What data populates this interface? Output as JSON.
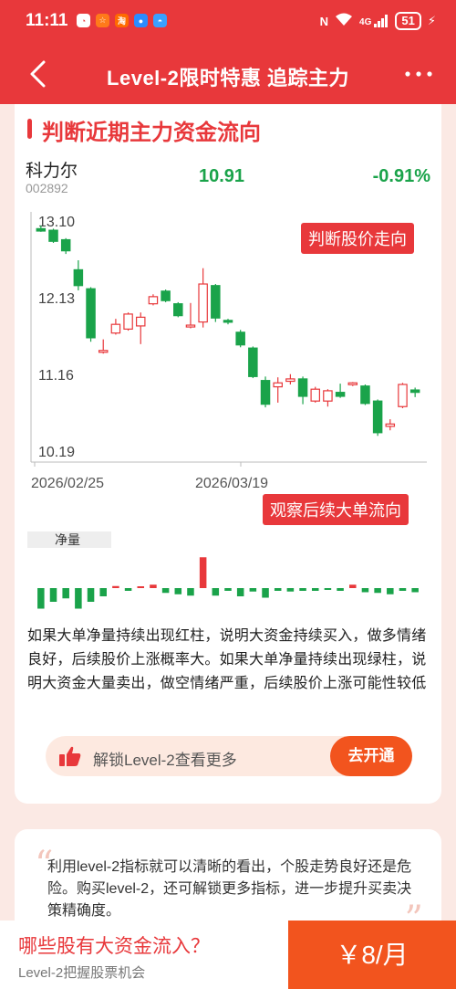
{
  "statusbar": {
    "time": "11:11",
    "apps": [
      "◔",
      "淘",
      "淘",
      "●",
      "◓"
    ],
    "network": "4G",
    "battery": "51"
  },
  "nav": {
    "title": "Level-2限时特惠 追踪主力"
  },
  "section": {
    "title": "判断近期主力资金流向"
  },
  "stock": {
    "name": "科力尔",
    "code": "002892",
    "price": "10.91",
    "change": "-0.91%"
  },
  "chart_data": {
    "type": "candlestick",
    "y_ticks": [
      "13.10",
      "12.13",
      "11.16",
      "10.19"
    ],
    "x_ticks": [
      "2026/02/25",
      "2026/03/19"
    ],
    "ylim": [
      10.19,
      13.1
    ],
    "candles": [
      {
        "o": 12.98,
        "c": 12.95,
        "h": 13.02,
        "l": 12.94
      },
      {
        "o": 12.96,
        "c": 12.82,
        "h": 12.98,
        "l": 12.8
      },
      {
        "o": 12.84,
        "c": 12.7,
        "h": 12.86,
        "l": 12.66
      },
      {
        "o": 12.46,
        "c": 12.26,
        "h": 12.58,
        "l": 12.2
      },
      {
        "o": 12.22,
        "c": 11.6,
        "h": 12.24,
        "l": 11.55
      },
      {
        "o": 11.42,
        "c": 11.44,
        "h": 11.58,
        "l": 11.4
      },
      {
        "o": 11.66,
        "c": 11.77,
        "h": 11.84,
        "l": 11.64
      },
      {
        "o": 11.71,
        "c": 11.9,
        "h": 11.92,
        "l": 11.69
      },
      {
        "o": 11.75,
        "c": 11.86,
        "h": 11.92,
        "l": 11.52
      },
      {
        "o": 12.03,
        "c": 12.12,
        "h": 12.15,
        "l": 12.01
      },
      {
        "o": 12.19,
        "c": 12.07,
        "h": 12.21,
        "l": 12.05
      },
      {
        "o": 12.03,
        "c": 11.88,
        "h": 12.05,
        "l": 11.86
      },
      {
        "o": 11.74,
        "c": 11.76,
        "h": 12.04,
        "l": 11.72
      },
      {
        "o": 11.8,
        "c": 12.28,
        "h": 12.48,
        "l": 11.73
      },
      {
        "o": 12.26,
        "c": 11.85,
        "h": 12.28,
        "l": 11.8
      },
      {
        "o": 11.82,
        "c": 11.8,
        "h": 11.84,
        "l": 11.77
      },
      {
        "o": 11.67,
        "c": 11.51,
        "h": 11.7,
        "l": 11.48
      },
      {
        "o": 11.47,
        "c": 11.11,
        "h": 11.49,
        "l": 11.09
      },
      {
        "o": 11.06,
        "c": 10.76,
        "h": 11.11,
        "l": 10.72
      },
      {
        "o": 10.98,
        "c": 11.03,
        "h": 11.1,
        "l": 10.78
      },
      {
        "o": 11.05,
        "c": 11.08,
        "h": 11.14,
        "l": 11.01
      },
      {
        "o": 11.08,
        "c": 10.86,
        "h": 11.11,
        "l": 10.76
      },
      {
        "o": 10.8,
        "c": 10.95,
        "h": 10.98,
        "l": 10.78
      },
      {
        "o": 10.8,
        "c": 10.93,
        "h": 10.95,
        "l": 10.73
      },
      {
        "o": 10.91,
        "c": 10.86,
        "h": 11.02,
        "l": 10.84
      },
      {
        "o": 11.02,
        "c": 11.03,
        "h": 11.04,
        "l": 10.99
      },
      {
        "o": 10.99,
        "c": 10.77,
        "h": 11.01,
        "l": 10.75
      },
      {
        "o": 10.8,
        "c": 10.4,
        "h": 10.82,
        "l": 10.36
      },
      {
        "o": 10.48,
        "c": 10.51,
        "h": 10.57,
        "l": 10.43
      },
      {
        "o": 10.73,
        "c": 11.01,
        "h": 11.03,
        "l": 10.71
      },
      {
        "o": 10.94,
        "c": 10.91,
        "h": 10.97,
        "l": 10.85
      }
    ],
    "net_volume_label": "净量",
    "net_volume": [
      -3,
      -2,
      -1.5,
      -3,
      -2,
      -1.2,
      0.3,
      -0.4,
      0.2,
      0.5,
      -0.7,
      -0.9,
      -1.1,
      4.5,
      -1.1,
      -0.4,
      -1.2,
      -0.5,
      -1.4,
      -0.4,
      -0.5,
      -0.4,
      -0.4,
      -0.2,
      -0.4,
      0.5,
      -0.6,
      -0.7,
      -0.9,
      -0.4,
      -0.6
    ],
    "colors": {
      "up": "#e8383b",
      "down": "#1aa34a",
      "axis": "#bbbbbb"
    }
  },
  "badges": {
    "trend": "判断股价走向",
    "flow": "观察后续大单流向"
  },
  "description": "如果大单净量持续出现红柱，说明大资金持续买入，做多情绪良好，后续股价上涨概率大。如果大单净量持续出现绿柱，说明大资金大量卖出，做空情绪严重，后续股价上涨可能性较低",
  "unlock": {
    "text": "解锁Level-2查看更多",
    "button": "去开通"
  },
  "quote": {
    "text": "利用level-2指标就可以清晰的看出，个股走势良好还是危险。购买level-2，还可解锁更多指标，进一步提升买卖决策精确度。"
  },
  "bottom": {
    "title": "哪些股有大资金流入？",
    "subtitle": "Level-2把握股票机会",
    "price": "￥8/月"
  }
}
